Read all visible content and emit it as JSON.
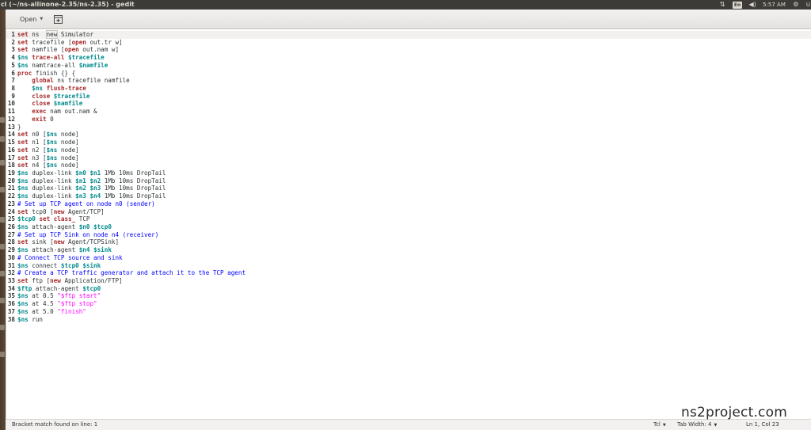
{
  "window": {
    "title": "cl (~/ns-allinone-2.35/ns-2.35) - gedit"
  },
  "system_tray": {
    "network_icon": "up-down-arrows-icon",
    "keyboard_layout": "En",
    "volume_icon": "speaker-icon",
    "time": "5:57 AM",
    "settings_icon": "gear-icon",
    "user": "U"
  },
  "toolbar": {
    "open_label": "Open",
    "new_icon": "new-document-icon"
  },
  "editor": {
    "lines": [
      "set ns  new Simulator",
      "set tracefile [open out.tr w]",
      "set namfile [open out.nam w]",
      "$ns trace-all $tracefile",
      "$ns namtrace-all $namfile",
      "proc finish {} {",
      "    global ns tracefile namfile",
      "    $ns flush-trace",
      "    close $tracefile",
      "    close $namfile",
      "    exec nam out.nam &",
      "    exit 0",
      "}",
      "set n0 [$ns node]",
      "set n1 [$ns node]",
      "set n2 [$ns node]",
      "set n3 [$ns node]",
      "set n4 [$ns node]",
      "$ns duplex-link $n0 $n1 1Mb 10ms DropTail",
      "$ns duplex-link $n1 $n2 1Mb 10ms DropTail",
      "$ns duplex-link $n2 $n3 1Mb 10ms DropTail",
      "$ns duplex-link $n3 $n4 1Mb 10ms DropTail",
      "# Set up TCP agent on node n0 (sender)",
      "set tcp0 [new Agent/TCP]",
      "$tcp0 set class_ TCP",
      "$ns attach-agent $n0 $tcp0",
      "# Set up TCP Sink on node n4 (receiver)",
      "set sink [new Agent/TCPSink]",
      "$ns attach-agent $n4 $sink",
      "# Connect TCP source and sink",
      "$ns connect $tcp0 $sink",
      "# Create a TCP traffic generator and attach it to the TCP agent",
      "set ftp [new Application/FTP]",
      "$ftp attach-agent $tcp0",
      "$ns at 0.5 \"$ftp start\"",
      "$ns at 4.5 \"$ftp stop\"",
      "$ns at 5.0 \"finish\"",
      "$ns run"
    ]
  },
  "statusbar": {
    "message": "Bracket match found on line: 1",
    "language": "Tcl",
    "tab_width": "Tab Width: 4",
    "cursor_position": "Ln 1, Col 23"
  },
  "watermark": "ns2project.com"
}
